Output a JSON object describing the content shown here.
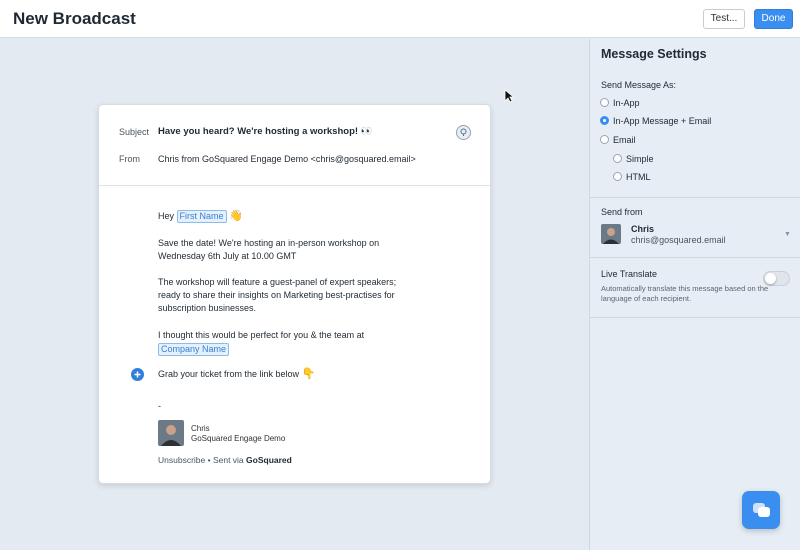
{
  "header": {
    "title": "New Broadcast",
    "test_label": "Test...",
    "done_label": "Done"
  },
  "email": {
    "subject_label": "Subject",
    "subject": "Have you heard? We're hosting a workshop! 👀",
    "from_label": "From",
    "from": "Chris from GoSquared Engage Demo <chris@gosquared.email>",
    "greeting": "Hey",
    "first_name_tag": "First Name",
    "wave_emoji": "👋",
    "para1_line1": "Save the date! We're hosting an in-person workshop on",
    "para1_line2": "Wednesday 6th July at 10.00 GMT",
    "para2_line1": "The workshop will feature a guest-panel of expert speakers;",
    "para2_line2": "ready to share their insights on Marketing best-practises for",
    "para2_line3": "subscription businesses.",
    "para3_line1": "I thought this would be perfect for you & the team at",
    "company_tag": "Company Name",
    "cta_line": "Grab your ticket from the link below",
    "point_emoji": "👇",
    "dash": "-",
    "sig_name": "Chris",
    "sig_company": "GoSquared Engage Demo",
    "footer_prefix": "Unsubscribe • Sent via ",
    "footer_brand": "GoSquared"
  },
  "settings": {
    "title": "Message Settings",
    "send_as_label": "Send Message As:",
    "options": [
      {
        "label": "In-App",
        "checked": false
      },
      {
        "label": "In-App Message + Email",
        "checked": true
      },
      {
        "label": "Email",
        "checked": false
      },
      {
        "label": "Simple",
        "checked": false
      },
      {
        "label": "HTML",
        "checked": false
      }
    ],
    "send_from_label": "Send from",
    "sender_name": "Chris",
    "sender_email": "chris@gosquared.email",
    "live_translate_title": "Live Translate",
    "live_translate_desc": "Automatically translate this message based on the language of each recipient.",
    "live_translate_on": false
  },
  "colors": {
    "accent": "#3a8ef0",
    "panel_bg": "#e6edf4"
  },
  "icons": {
    "hint": "lightbulb-icon",
    "add": "plus-icon",
    "chat": "chat-icon",
    "dropdown": "chevron-down-icon"
  }
}
